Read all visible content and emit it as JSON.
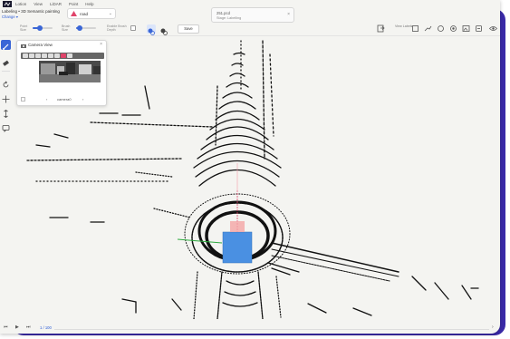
{
  "menu": {
    "items": [
      "Lotion",
      "View",
      "LiDAR",
      "Point",
      "Help"
    ]
  },
  "project": {
    "title": "Labeling • 3D Semantic painting",
    "change_label": "Change"
  },
  "class_select": {
    "value": "road",
    "color": "#e0436a"
  },
  "file": {
    "name": "251.pcd",
    "stage": "Stage: Labelling"
  },
  "toolbar": {
    "point_size_label": "Point Size",
    "brush_size_label": "Brush Size",
    "enable_depth_label": "Enable Brush Depth",
    "save_label": "Save",
    "view_labels_label": "View Labels",
    "point_size_value": 0.35,
    "brush_size_value": 0.1
  },
  "camera_view": {
    "title": "Camera View",
    "camera_name": "camera0",
    "prev": "‹",
    "next": "›"
  },
  "playback": {
    "frame": "1 / 100"
  },
  "colors": {
    "accent": "#3b2aa8",
    "primary": "#3a66d6",
    "cuboid": "#4a90e2",
    "background": "#f4f4f1"
  },
  "icons": {
    "left_tools": [
      "brush-icon",
      "eraser-icon",
      "rotate-icon",
      "move-icon",
      "height-icon",
      "comment-icon"
    ],
    "right_tools": [
      "export-icon",
      "line-icon",
      "square-icon",
      "polyline-icon",
      "circle-icon",
      "target-icon",
      "image-icon",
      "eye-icon"
    ]
  }
}
